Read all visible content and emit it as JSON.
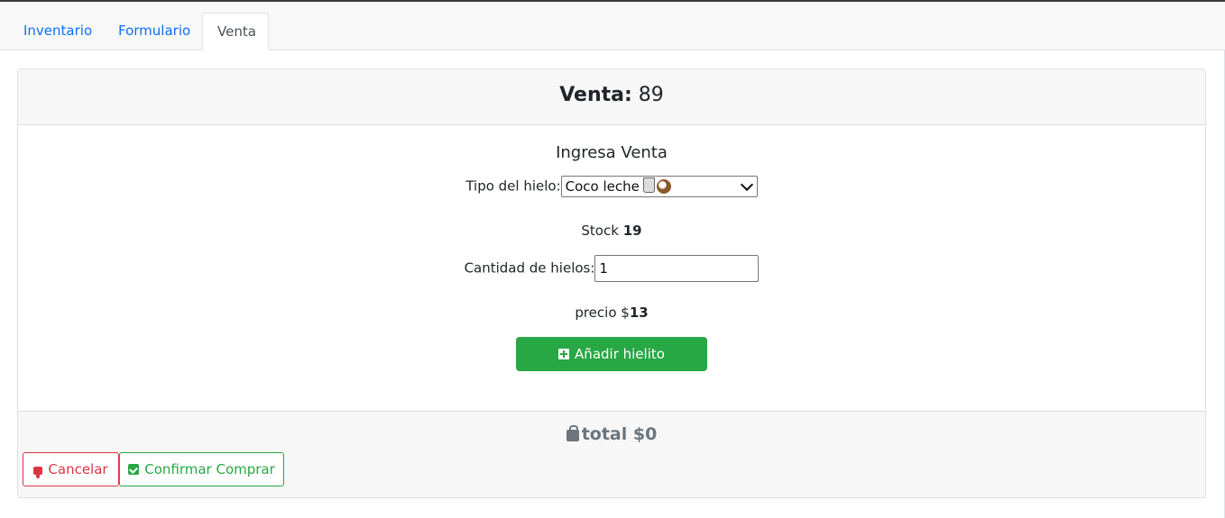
{
  "tabs": [
    {
      "label": "Inventario",
      "active": false
    },
    {
      "label": "Formulario",
      "active": false
    },
    {
      "label": "Venta",
      "active": true
    }
  ],
  "header": {
    "label": "Venta:",
    "value": "89"
  },
  "form": {
    "title": "Ingresa Venta",
    "tipo_label": "Tipo del hielo:",
    "tipo_selected": "Coco leche",
    "tipo_icons": [
      "milk-glass-icon",
      "coconut-icon"
    ],
    "stock_label": "Stock",
    "stock_value": "19",
    "cantidad_label": "Cantidad de hielos:",
    "cantidad_value": "1",
    "precio_label": "precio $",
    "precio_value": "13",
    "add_button": "Añadir hielito"
  },
  "footer": {
    "total_label": "total $",
    "total_value": "0",
    "cancel_button": "Cancelar",
    "confirm_button": "Confirmar Comprar"
  },
  "colors": {
    "link": "#0d6efd",
    "success": "#28a745",
    "danger": "#dc3545",
    "muted": "#6c757d"
  }
}
